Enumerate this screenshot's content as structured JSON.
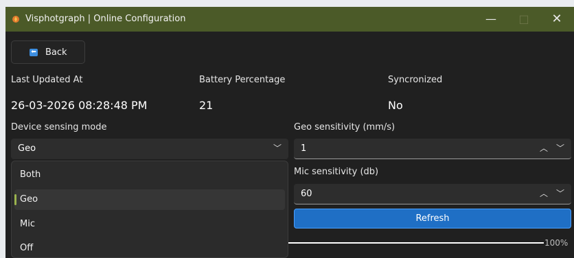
{
  "window": {
    "title": "Visphotgraph | Online Configuration",
    "controls": {
      "minimize": "—",
      "maximize": "□",
      "close": "✕"
    },
    "accent_color": "#4b5a28"
  },
  "back_button": {
    "label": "Back",
    "icon": "back-arrow-icon"
  },
  "status": {
    "last_updated": {
      "label": "Last Updated At",
      "value": "26-03-2026 08:28:48 PM"
    },
    "battery": {
      "label": "Battery Percentage",
      "value": "21"
    },
    "synchronized": {
      "label": "Syncronized",
      "value": "No"
    }
  },
  "sensing_mode": {
    "label": "Device sensing mode",
    "selected": "Geo",
    "options": [
      "Both",
      "Geo",
      "Mic",
      "Off"
    ]
  },
  "geo_sensitivity": {
    "label": "Geo sensitivity (mm/s)",
    "value": "1"
  },
  "mic_sensitivity": {
    "label": "Mic sensitivity (db)",
    "value": "60"
  },
  "refresh_button": {
    "label": "Refresh",
    "color": "#1f6fc5"
  },
  "progress": {
    "value": 1.0,
    "label": "100%"
  }
}
